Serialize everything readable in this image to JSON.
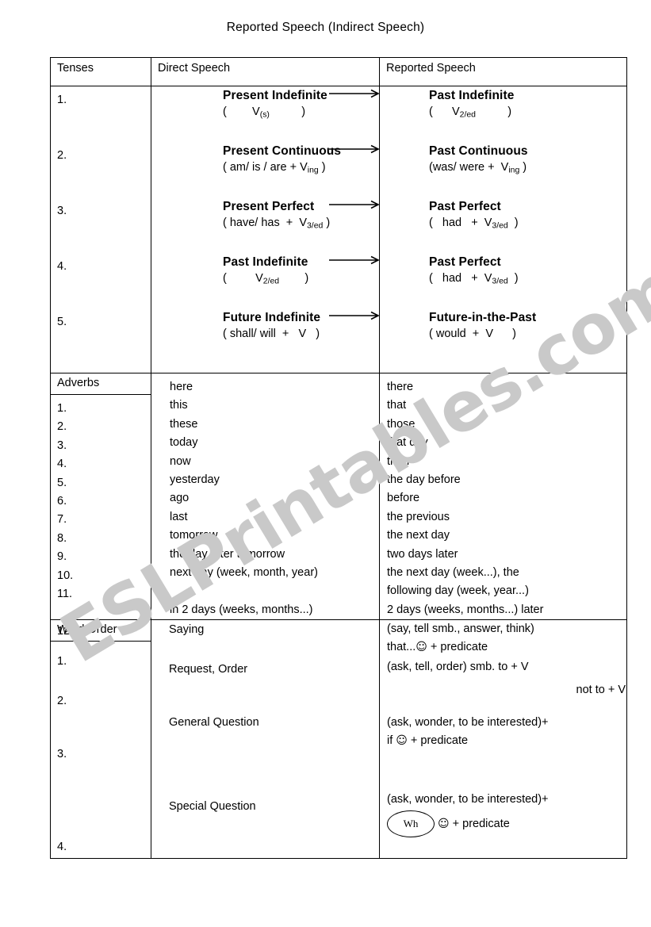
{
  "title": "Reported Speech (Indirect Speech)",
  "watermark": "ESLPrintables.com",
  "table": {
    "headers": {
      "col1": "Tenses",
      "col2": "Direct Speech",
      "col3": "Reported Speech"
    },
    "tenses": [
      {
        "num": "1.",
        "direct_name": "Present Indefinite",
        "direct_form": "(        V(s)          )",
        "reported_name": "Past Indefinite",
        "reported_form": "(      V2/ed          )"
      },
      {
        "num": "2.",
        "direct_name": "Present Continuous",
        "direct_form": "( am/ is / are + Ving )",
        "reported_name": "Past Continuous",
        "reported_form": "(was/ were +  Ving )"
      },
      {
        "num": "3.",
        "direct_name": "Present Perfect",
        "direct_form": "( have/ has  +  V3/ed )",
        "reported_name": "Past Perfect",
        "reported_form": "(   had   +  V3/ed  )"
      },
      {
        "num": "4.",
        "direct_name": "Past Indefinite",
        "direct_form": "(         V2/ed        )",
        "reported_name": "Past Perfect",
        "reported_form": "(   had   +  V3/ed  )"
      },
      {
        "num": "5.",
        "direct_name": "Future Indefinite",
        "direct_form": "( shall/ will  +   V   )",
        "reported_name": "Future-in-the-Past",
        "reported_form": "( would  +  V      )"
      }
    ],
    "adverbs_label": "Adverbs",
    "adverbs": [
      {
        "num": "1.",
        "direct": "here",
        "reported": "there"
      },
      {
        "num": "2.",
        "direct": "this",
        "reported": "that"
      },
      {
        "num": "3.",
        "direct": "these",
        "reported": "those"
      },
      {
        "num": "4.",
        "direct": "today",
        "reported": "that day"
      },
      {
        "num": "5.",
        "direct": "now",
        "reported": "then"
      },
      {
        "num": "6.",
        "direct": "yesterday",
        "reported": "the day before"
      },
      {
        "num": "7.",
        "direct": "ago",
        "reported": "before"
      },
      {
        "num": "8.",
        "direct": "last",
        "reported": "the previous"
      },
      {
        "num": "9.",
        "direct": "tomorrow",
        "reported": "the next day"
      },
      {
        "num": "10.",
        "direct": "the day after tomorrow",
        "reported": "two days later"
      },
      {
        "num": "11.",
        "direct": "next day (week, month, year)",
        "reported": "the next day (week...), the"
      },
      {
        "num": "",
        "direct": "",
        "reported": "following day (week, year...)"
      },
      {
        "num": "12.",
        "direct": "in 2 days (weeks, months...)",
        "reported": "2 days (weeks, months...) later"
      }
    ],
    "word_order_label": "Word Order",
    "word_order": [
      {
        "num": "1.",
        "direct": "Saying",
        "reported_line1": "(say, tell smb., answer, think)",
        "reported_line2_pre": "that...",
        "reported_line2_post": " + predicate",
        "reported_line3": ""
      },
      {
        "num": "2.",
        "direct": "Request, Order",
        "reported_line1": "(ask, tell, order) smb. to + V",
        "reported_line2_pre": "",
        "reported_line2_post": "",
        "reported_line3": "not  to + V"
      },
      {
        "num": "3.",
        "direct": "General Question",
        "reported_line1": "(ask, wonder, to be interested)+",
        "reported_line2_pre": "if   ",
        "reported_line2_post": " + predicate",
        "reported_line3": ""
      },
      {
        "num": "4.",
        "direct": "Special Question",
        "reported_line1": "(ask, wonder, to be interested)+",
        "reported_line2_pre": "Wh",
        "reported_line2_post": " + predicate",
        "reported_line3": ""
      }
    ],
    "smiley_glyph": "☺"
  }
}
